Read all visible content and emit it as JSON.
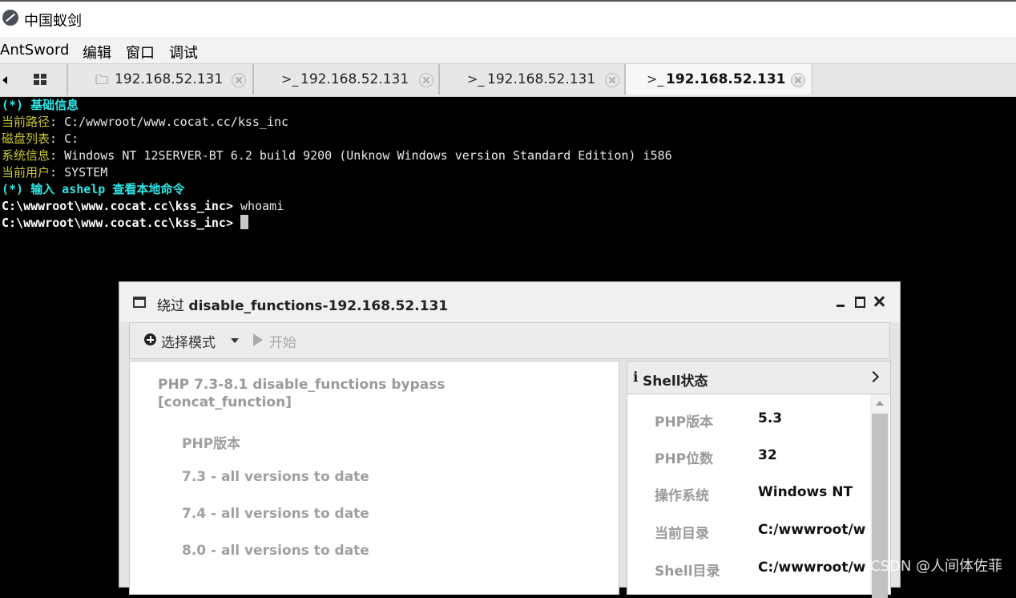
{
  "app": {
    "title": "中国蚁剑",
    "icon": "antsword-logo-icon"
  },
  "menu": [
    "AntSword",
    "编辑",
    "窗口",
    "调试"
  ],
  "tabs": [
    {
      "icon": "folder-icon",
      "label": "192.168.52.131"
    },
    {
      "icon": "terminal-icon",
      "label": "192.168.52.131"
    },
    {
      "icon": "terminal-icon",
      "label": "192.168.52.131"
    },
    {
      "icon": "terminal-icon",
      "label": "192.168.52.131",
      "active": true
    }
  ],
  "terminal": {
    "lines": [
      {
        "segments": [
          {
            "text": "(*) 基础信息",
            "style": "cyan"
          }
        ]
      },
      {
        "segments": [
          {
            "text": "当前路径",
            "style": "olive"
          },
          {
            "text": ": C:/wwwroot/www.cocat.cc/kss_inc",
            "style": "white"
          }
        ]
      },
      {
        "segments": [
          {
            "text": "磁盘列表",
            "style": "olive"
          },
          {
            "text": ": C:",
            "style": "white"
          }
        ]
      },
      {
        "segments": [
          {
            "text": "系统信息",
            "style": "olive"
          },
          {
            "text": ": Windows NT 12SERVER-BT 6.2 build 9200 (Unknow Windows version Standard Edition) i586",
            "style": "white"
          }
        ]
      },
      {
        "segments": [
          {
            "text": "当前用户",
            "style": "olive"
          },
          {
            "text": ": SYSTEM",
            "style": "white"
          }
        ]
      },
      {
        "segments": [
          {
            "text": "(*) 输入 ashelp 查看本地命令",
            "style": "cyan"
          }
        ]
      },
      {
        "segments": [
          {
            "text": "C:\\wwwroot\\www.cocat.cc\\kss_inc> ",
            "style": "bold"
          },
          {
            "text": "whoami",
            "style": "white"
          }
        ]
      },
      {
        "segments": [
          {
            "text": "C:\\wwwroot\\www.cocat.cc\\kss_inc> ",
            "style": "bold"
          }
        ],
        "cursor": true
      }
    ]
  },
  "dialog": {
    "title_prefix": "绕过",
    "title_main": "disable_functions-192.168.52.131",
    "toolbar": {
      "mode_label": "选择模式",
      "start_label": "开始"
    },
    "left": {
      "title": "PHP 7.3-8.1 disable_functions bypass [concat_function]",
      "items": [
        "PHP版本",
        "7.3 - all versions to date",
        "7.4 - all versions to date",
        "8.0 - all versions to date"
      ]
    },
    "right": {
      "header": "Shell状态",
      "props": [
        {
          "key": "PHP版本",
          "value": "5.3"
        },
        {
          "key": "PHP位数",
          "value": "32"
        },
        {
          "key": "操作系统",
          "value": "Windows NT"
        },
        {
          "key": "当前目录",
          "value": "C:/wwwroot/w"
        },
        {
          "key": "Shell目录",
          "value": "C:/wwwroot/w"
        }
      ]
    }
  },
  "watermark": "CSDN @人间体佐菲"
}
